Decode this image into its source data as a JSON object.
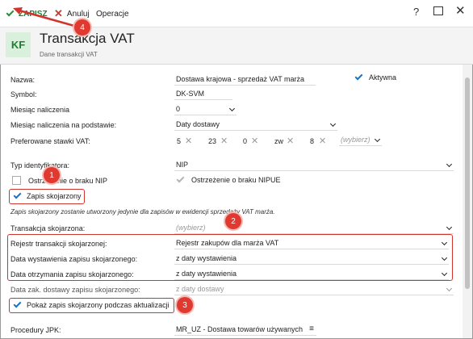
{
  "toolbar": {
    "save_label": "ZAPISZ",
    "cancel_label": "Anuluj",
    "operations_label": "Operacje",
    "help_label": "?"
  },
  "header": {
    "logo": "KF",
    "title": "Transakcja VAT",
    "subtitle": "Dane transakcji VAT"
  },
  "form": {
    "nazwa_label": "Nazwa:",
    "nazwa_value": "Dostawa krajowa - sprzedaż VAT marża",
    "aktywna_label": "Aktywna",
    "symbol_label": "Symbol:",
    "symbol_value": "DK-SVM",
    "miesiac_label": "Miesiąc naliczenia",
    "miesiac_value": "0",
    "miesiac_podstawa_label": "Miesiąc naliczenia na podstawie:",
    "miesiac_podstawa_value": "Daty dostawy",
    "stawki_label": "Preferowane stawki VAT:",
    "stawki": [
      "5",
      "23",
      "0",
      "zw",
      "8"
    ],
    "stawki_placeholder": "(wybierz)",
    "typ_label": "Typ identyfikatora:",
    "typ_value": "NIP",
    "ostrz_nip_label": "Ostrzeżenie o braku NIP",
    "ostrz_nipue_label": "Ostrzeżenie o braku NIPUE",
    "zapis_skojarzony_label": "Zapis skojarzony",
    "info_text": "Zapis skojarzony zostanie utworzony jedynie dla zapisów w ewidencji sprzedaży VAT marża.",
    "transakcja_skoj_label": "Transakcja skojarzona:",
    "transakcja_skoj_placeholder": "(wybierz)",
    "rejestr_label": "Rejestr transakcji skojarzonej:",
    "rejestr_value": "Rejestr zakupów dla marża VAT",
    "data_wyst_label": "Data wystawienia zapisu skojarzonego:",
    "data_wyst_value": "z daty wystawienia",
    "data_otrz_label": "Data otrzymania zapisu skojarzonego:",
    "data_otrz_value": "z daty wystawienia",
    "data_zak_label": "Data zak. dostawy zapisu skojarzonego:",
    "data_zak_value": "z daty dostawy",
    "pokaz_label": "Pokaż zapis skojarzony podczas aktualizacji",
    "procedury_label": "Procedury JPK:",
    "procedury_value": "MR_UZ - Dostawa towarów używanych"
  },
  "badges": [
    "1",
    "2",
    "3",
    "4"
  ],
  "colors": {
    "accent_green": "#1e7d2f",
    "check_blue": "#1a73c9",
    "highlight_red": "#d0342c"
  }
}
